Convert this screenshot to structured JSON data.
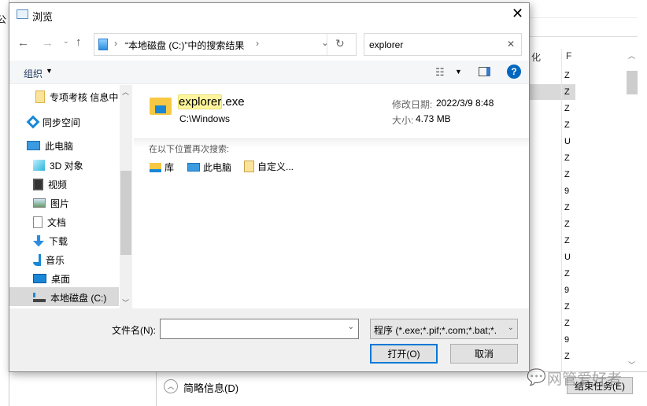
{
  "background": {
    "left_fragment": "公",
    "right_col_headers": [
      "化",
      "F"
    ],
    "right_cells": [
      "Z",
      "Z",
      "Z",
      "Z",
      "U",
      "Z",
      "Z",
      "9",
      "Z",
      "Z",
      "Z",
      "U",
      "Z",
      "9",
      "Z",
      "Z",
      "9",
      "Z"
    ],
    "brief_info": "简略信息(D)",
    "end_task": "结束任务(E)",
    "watermark": "网管爱好者"
  },
  "dialog": {
    "title": "浏览",
    "address": "“本地磁盘 (C:)”中的搜索结果",
    "search_value": "explorer",
    "organize": "组织",
    "sidebar": [
      {
        "label": "专项考核 信息中",
        "icon": "folder-icon"
      },
      {
        "label": "同步空间",
        "icon": "sync-space-icon"
      },
      {
        "label": "此电脑",
        "icon": "computer-icon"
      },
      {
        "label": "3D 对象",
        "icon": "3d-objects-icon"
      },
      {
        "label": "视频",
        "icon": "video-icon"
      },
      {
        "label": "图片",
        "icon": "pictures-icon"
      },
      {
        "label": "文档",
        "icon": "documents-icon"
      },
      {
        "label": "下载",
        "icon": "download-icon"
      },
      {
        "label": "音乐",
        "icon": "music-icon"
      },
      {
        "label": "桌面",
        "icon": "desktop-icon"
      },
      {
        "label": "本地磁盘 (C:)",
        "icon": "drive-icon"
      }
    ],
    "result": {
      "name_highlight": "explorer",
      "name_rest": ".exe",
      "path": "C:\\Windows",
      "modified_label": "修改日期:",
      "modified": "2022/3/9 8:48",
      "size_label": "大小:",
      "size": "4.73 MB"
    },
    "search_again_label": "在以下位置再次搜索:",
    "search_again": [
      "库",
      "此电脑",
      "自定义..."
    ],
    "filename_label": "文件名(N):",
    "filename_value": "",
    "filetype": "程序 (*.exe;*.pif;*.com;*.bat;*.",
    "open": "打开(O)",
    "cancel": "取消"
  },
  "colors": {
    "accent": "#0078d7",
    "highlight": "#fff59d",
    "selected": "#d9d9d9"
  }
}
